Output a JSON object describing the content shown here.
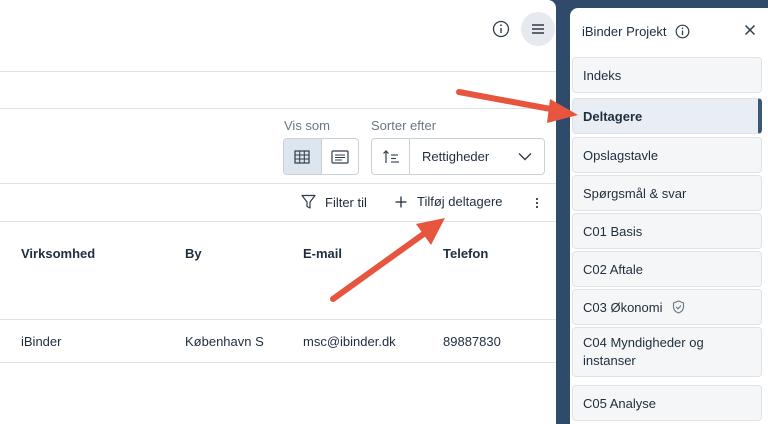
{
  "toolbar": {
    "info_icon": "info-circle-icon",
    "menu_icon": "hamburger-menu-icon"
  },
  "controls": {
    "view_label": "Vis som",
    "sort_label": "Sorter efter",
    "sort_value": "Rettigheder",
    "view_options": [
      "table-grid-icon",
      "list-card-icon"
    ]
  },
  "actions": {
    "filter_label": "Filter til",
    "add_label": "Tilføj deltagere"
  },
  "table": {
    "headers": [
      "Virksomhed",
      "By",
      "E-mail",
      "Telefon"
    ],
    "rows": [
      [
        "iBinder",
        "København S",
        "msc@ibinder.dk",
        "89887830"
      ]
    ]
  },
  "side_panel": {
    "title": "iBinder Projekt",
    "items": [
      {
        "label": "Indeks",
        "active": false
      },
      {
        "label": "Deltagere",
        "active": true
      },
      {
        "label": "Opslagstavle",
        "active": false
      },
      {
        "label": "Spørgsmål & svar",
        "active": false
      },
      {
        "label": "C01 Basis",
        "active": false
      },
      {
        "label": "C02 Aftale",
        "active": false
      },
      {
        "label": "C03 Økonomi",
        "active": false,
        "icon": "shield-check-icon"
      },
      {
        "label": "C04 Myndigheder og instanser",
        "active": false
      },
      {
        "label": "C05 Analyse",
        "active": false
      }
    ]
  },
  "colors": {
    "frame": "#2f4a6b",
    "annotation_arrow": "#e8553f",
    "active_accent": "#3a5779"
  }
}
